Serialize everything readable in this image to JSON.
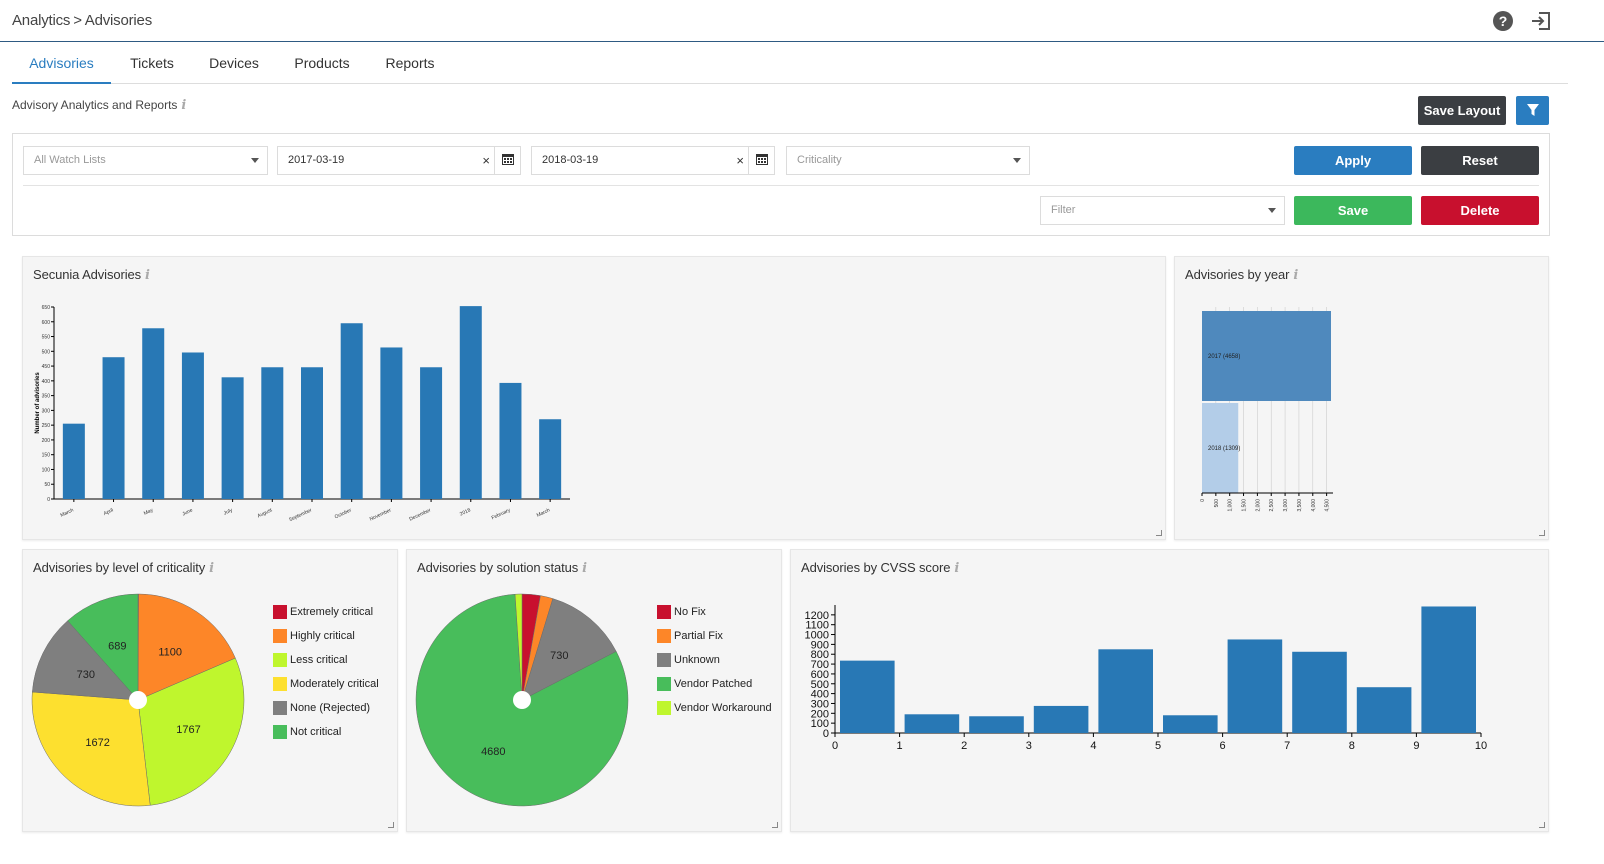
{
  "breadcrumb": {
    "root": "Analytics",
    "separator": ">",
    "current": "Advisories"
  },
  "tabs": [
    "Advisories",
    "Tickets",
    "Devices",
    "Products",
    "Reports"
  ],
  "active_tab": "Advisories",
  "subtitle": "Advisory Analytics and Reports",
  "actions": {
    "save_layout": "Save Layout",
    "filter_toggle_icon": "funnel-icon"
  },
  "filters": {
    "watch_list_placeholder": "All Watch Lists",
    "date_from": "2017-03-19",
    "date_to": "2018-03-19",
    "criticality_placeholder": "Criticality",
    "filter_placeholder": "Filter",
    "apply": "Apply",
    "reset": "Reset",
    "save": "Save",
    "delete": "Delete",
    "clear_symbol": "×"
  },
  "colors": {
    "primary": "#2a7dc0",
    "dark": "#3b3e42",
    "success": "#3cb85c",
    "danger": "#c8102e",
    "bar": "#2878b5"
  },
  "cards": {
    "secunia": "Secunia Advisories",
    "by_year": "Advisories by year",
    "criticality": "Advisories by level of criticality",
    "solution": "Advisories by solution status",
    "cvss": "Advisories by CVSS score"
  },
  "chart_data": [
    {
      "id": "secunia",
      "type": "bar",
      "title": "Secunia Advisories",
      "ylabel": "Number of advisories",
      "categories": [
        "March",
        "April",
        "May",
        "June",
        "July",
        "August",
        "September",
        "October",
        "November",
        "December",
        "2018",
        "February",
        "March"
      ],
      "values": [
        255,
        480,
        578,
        496,
        412,
        446,
        446,
        595,
        513,
        446,
        653,
        393,
        270
      ],
      "ylim": [
        0,
        650
      ],
      "yticks": [
        0,
        50,
        100,
        150,
        200,
        250,
        300,
        350,
        400,
        450,
        500,
        550,
        600,
        650
      ]
    },
    {
      "id": "by_year",
      "type": "bar",
      "orientation": "horizontal",
      "title": "Advisories by year",
      "categories": [
        "2017 (4658)",
        "2018 (1309)"
      ],
      "values": [
        4658,
        1309
      ],
      "xlim": [
        0,
        4658
      ],
      "xticks": [
        "0",
        "500",
        "1,000",
        "1,500",
        "2,000",
        "2,500",
        "3,000",
        "3,500",
        "4,000",
        "4,500"
      ],
      "colors": [
        "#4f89bd",
        "#b3cde8"
      ]
    },
    {
      "id": "criticality",
      "type": "pie",
      "title": "Advisories by level of criticality",
      "labels": [
        "Extremely critical",
        "Highly critical",
        "Less critical",
        "Moderately critical",
        "None (Rejected)",
        "Not critical"
      ],
      "values": [
        5,
        1100,
        1767,
        1672,
        730,
        689
      ],
      "slice_order": [
        "Extremely critical",
        "Highly critical",
        "Less critical",
        "Moderately critical",
        "None (Rejected)",
        "Not critical"
      ],
      "colors": [
        "#c8102e",
        "#fd8628",
        "#bff62d",
        "#fde02f",
        "#7f7f7f",
        "#48bd5b"
      ],
      "data_labels": [
        "",
        "1100",
        "1767",
        "1672",
        "730",
        "689"
      ]
    },
    {
      "id": "solution",
      "type": "pie",
      "title": "Advisories by solution status",
      "labels": [
        "No Fix",
        "Partial Fix",
        "Unknown",
        "Vendor Patched",
        "Vendor Workaround"
      ],
      "slice_values": [
        160,
        110,
        730,
        4680,
        60
      ],
      "slice_colors": [
        "#c8102e",
        "#fd8628",
        "#7f7f7f",
        "#48bd5b",
        "#bff62d"
      ],
      "data_labels": [
        "",
        "",
        "730",
        "4680",
        ""
      ]
    },
    {
      "id": "cvss",
      "type": "bar",
      "title": "Advisories by CVSS score",
      "x_edges": [
        0,
        1,
        2,
        3,
        4,
        5,
        6,
        7,
        8,
        9,
        10
      ],
      "values": [
        735,
        190,
        170,
        275,
        850,
        180,
        950,
        825,
        465,
        1285
      ],
      "ylim": [
        0,
        1300
      ],
      "yticks": [
        0,
        100,
        200,
        300,
        400,
        500,
        600,
        700,
        800,
        900,
        1000,
        1100,
        1200
      ],
      "xticks": [
        0,
        1,
        2,
        3,
        4,
        5,
        6,
        7,
        8,
        9,
        10
      ]
    }
  ]
}
